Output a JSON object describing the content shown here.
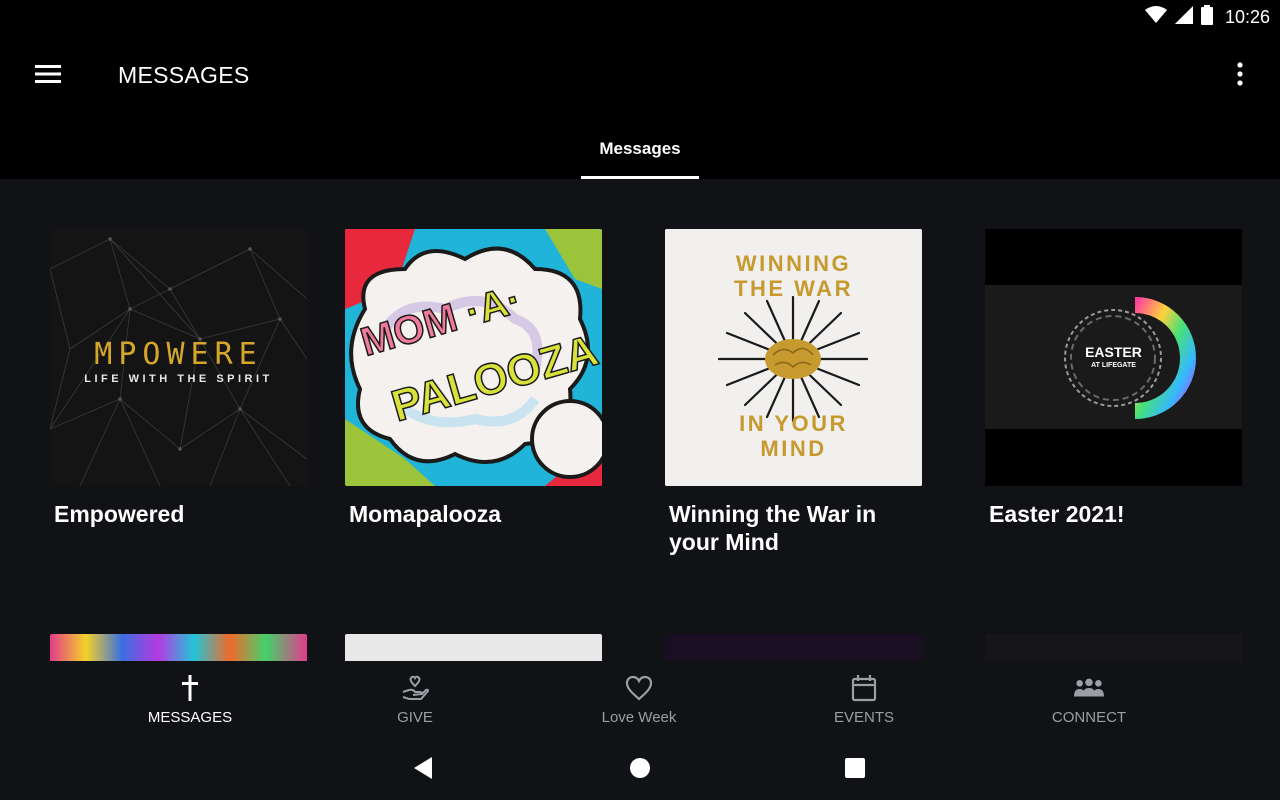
{
  "status_bar": {
    "time": "10:26"
  },
  "app_bar": {
    "title": "MESSAGES"
  },
  "tabs": [
    {
      "label": "Messages",
      "active": true
    }
  ],
  "cards": [
    {
      "title": "Empowered",
      "art_line1": "MPOWERE",
      "art_line2": "LIFE WITH THE SPIRIT"
    },
    {
      "title": "Momapalooza",
      "art_line1": "MOM",
      "art_dot": "·A·",
      "art_line2": "PALOOZA"
    },
    {
      "title": "Winning the War in your Mind",
      "art_line1": "WINNING",
      "art_line2": "THE WAR",
      "art_line3": "IN YOUR",
      "art_line4": "MIND"
    },
    {
      "title": "Easter 2021!",
      "art_line1": "EASTER",
      "art_line2": "AT LIFEGATE"
    }
  ],
  "bottom_nav": [
    {
      "label": "MESSAGES",
      "icon": "cross-icon",
      "active": true
    },
    {
      "label": "GIVE",
      "icon": "give-hand-heart-icon",
      "active": false
    },
    {
      "label": "Love Week",
      "icon": "heart-icon",
      "active": false
    },
    {
      "label": "EVENTS",
      "icon": "calendar-icon",
      "active": false
    },
    {
      "label": "CONNECT",
      "icon": "group-icon",
      "active": false
    }
  ],
  "colors": {
    "background": "#000000",
    "content_background": "#111215",
    "inactive_nav": "#9b9ea4",
    "gold": "#c9a227"
  }
}
